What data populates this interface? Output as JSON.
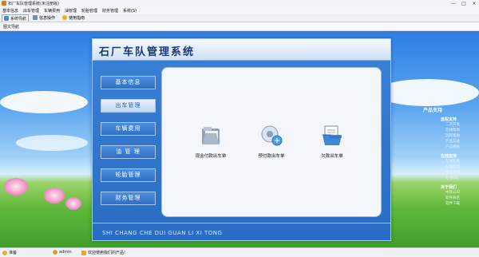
{
  "window": {
    "title": "石厂车队管理系统(未注册版)",
    "controls": [
      "—",
      "□",
      "×"
    ]
  },
  "menu": [
    "基本信息",
    "出车管理",
    "车辆费用",
    "油管理",
    "轮胎管理",
    "财务管理",
    "系统(S)"
  ],
  "tabs": [
    {
      "label": "系统导航",
      "active": true
    },
    {
      "label": "信息操作",
      "active": false
    },
    {
      "label": "使用指南",
      "active": false
    }
  ],
  "subheader": "图文导航",
  "panel": {
    "title": "石厂车队管理系统",
    "footer": "SHI CHANG CHE DUI GUAN LI XI TONG",
    "nav": [
      {
        "label": "基本信息",
        "selected": false
      },
      {
        "label": "出车管理",
        "selected": true
      },
      {
        "label": "车辆费用",
        "selected": false
      },
      {
        "label": "油 管 理",
        "selected": false
      },
      {
        "label": "轮胎管理",
        "selected": false
      },
      {
        "label": "财务管理",
        "selected": false
      }
    ],
    "actions": [
      {
        "label": "现金付款出车单",
        "icon": "folder-icon"
      },
      {
        "label": "预付款出车单",
        "icon": "gear-globe-icon"
      },
      {
        "label": "欠款出车单",
        "icon": "document-folder-icon"
      }
    ]
  },
  "support": {
    "title": "产品支持",
    "sections": [
      {
        "heading": "远程支持",
        "links": [
          "二次开发",
          "在线帮助",
          "远程帮助",
          "产品方式",
          "产品相关"
        ]
      },
      {
        "heading": "在线支持",
        "links": [
          "在线客服",
          "在线反馈",
          "联系方式",
          "在线QQ"
        ]
      },
      {
        "heading": "关于我们",
        "links": [
          "中软公司",
          "软件商店",
          "软件下载"
        ]
      }
    ]
  },
  "status": {
    "left": "准备",
    "user": "admin",
    "message": "欢迎使用我们的产品!"
  },
  "colors": {
    "panel": "#2f74cc",
    "accent": "#173a74",
    "sky": "#2f7fe3"
  }
}
